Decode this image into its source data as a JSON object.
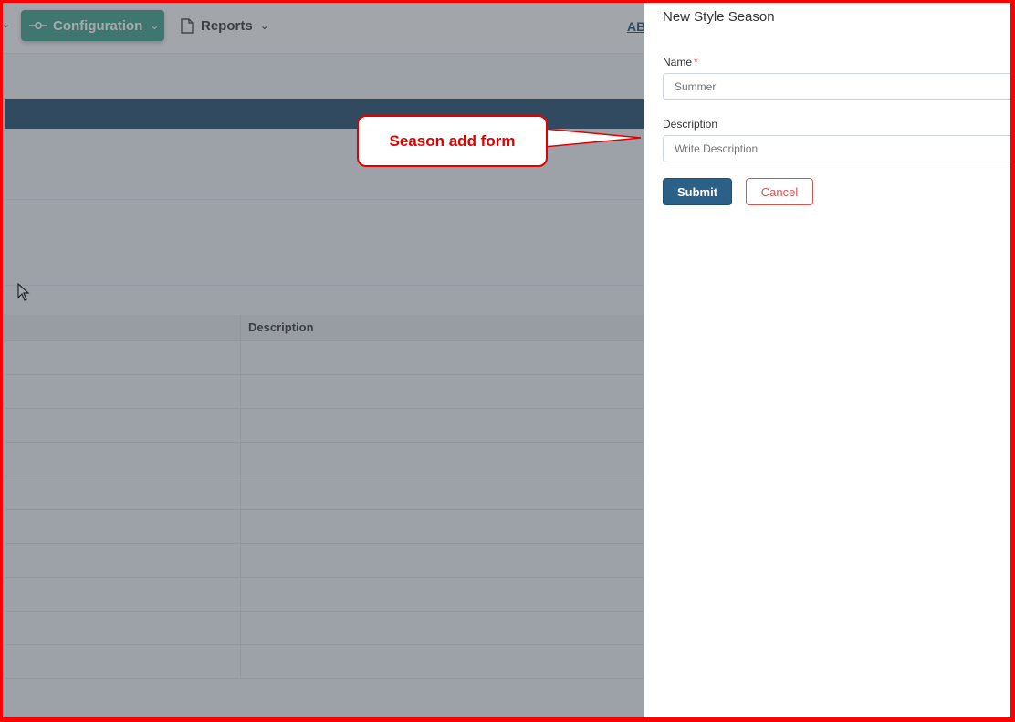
{
  "nav": {
    "config_label": "Configuration",
    "reports_label": "Reports",
    "abbr": "AB"
  },
  "table": {
    "headers": [
      "",
      "Description"
    ],
    "row_count": 10
  },
  "panel": {
    "title": "New Style Season",
    "name_label": "Name",
    "name_required_mark": "*",
    "name_placeholder": "Summer",
    "description_label": "Description",
    "description_placeholder": "Write Description",
    "submit_label": "Submit",
    "cancel_label": "Cancel"
  },
  "annotation": {
    "text": "Season add form"
  },
  "colors": {
    "accent": "#3a9e8a",
    "primary": "#2c6187",
    "danger": "#d9534f",
    "annotation": "#e00000"
  }
}
